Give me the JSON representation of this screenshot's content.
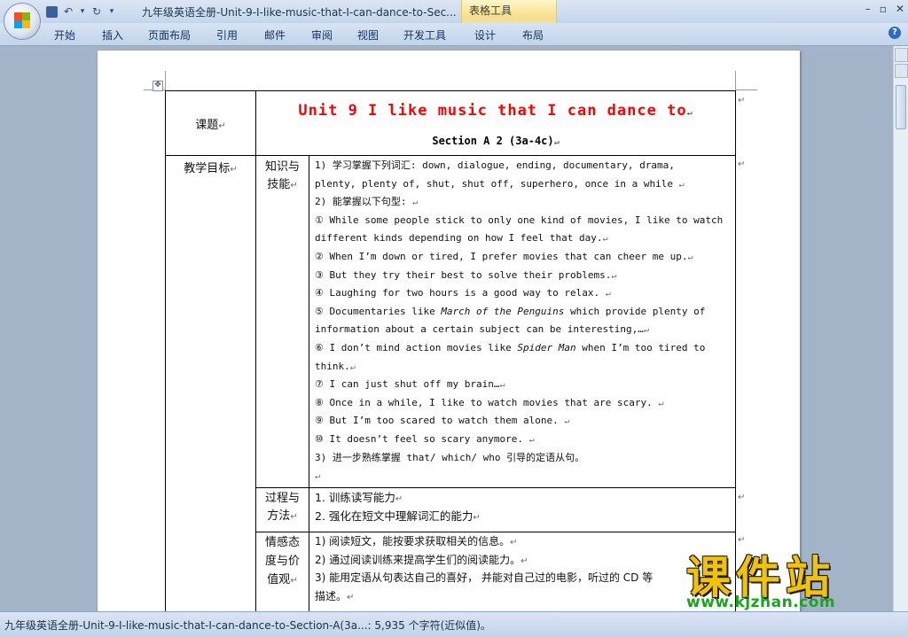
{
  "window": {
    "title": "九年级英语全册-Unit-9-I-like-music-that-I-can-dance-to-Sec...",
    "contextual_group": "表格工具",
    "controls": [
      "–",
      "▫",
      "✕"
    ]
  },
  "quick_access": {
    "undo_icon": "↶",
    "dropdown_icon": "▾",
    "redo_icon": "↻",
    "customize_icon": "▾"
  },
  "ribbon": {
    "tabs": [
      "开始",
      "插入",
      "页面布局",
      "引用",
      "邮件",
      "审阅",
      "视图",
      "开发工具",
      "设计",
      "布局"
    ],
    "help_icon": "?"
  },
  "document": {
    "table_handle": "✥",
    "paragraph_mark": "↵",
    "topic_label": "课题",
    "title": "Unit 9 I like music that I can dance to",
    "section": "Section A 2 (3a-4c)",
    "goals_label": "教学目标",
    "knowledge_label_1": "知识与",
    "knowledge_label_2": "技能",
    "knowledge_lines": {
      "l1": "1) 学习掌握下列词汇: down, dialogue, ending, documentary, drama,",
      "l2": "plenty, plenty of, shut, shut off, superhero, once in a while",
      "l3": "2) 能掌握以下句型:",
      "l4": "① While some people stick to only one kind of movies, I like to watch",
      "l5": "different kinds depending on how I feel that day.",
      "l6": "② When I’m down or tired, I prefer movies that can cheer me up.",
      "l7": "③ But they try their best to solve their problems.",
      "l8": "④ Laughing for two hours is a good way to relax.",
      "l9a": "⑤ Documentaries like ",
      "l9b": "March of the Penguins",
      "l9c": " which provide plenty of",
      "l10": "information about a certain subject can be interesting,…",
      "l11a": "⑥ I don’t mind action movies like ",
      "l11b": "Spider Man",
      "l11c": " when I’m too tired to",
      "l12": "think.",
      "l13": "⑦ I can just shut off my brain…",
      "l14": "⑧ Once in a while, I like to watch movies that are scary.",
      "l15": "⑨ But I’m too scared to watch them alone.",
      "l16": "⑩ It doesn’t feel so scary anymore.",
      "l17": "3) 进一步熟练掌握 that/ which/ who 引导的定语从句。"
    },
    "process_label_1": "过程与",
    "process_label_2": "方法",
    "process_lines": [
      "1.  训练读写能力",
      "2.  强化在短文中理解词汇的能力"
    ],
    "emotion_label_1": "情感态",
    "emotion_label_2": "度与价",
    "emotion_label_3": "值观",
    "emotion_lines": [
      "1) 阅读短文，能按要求获取相关的信息。",
      "2) 通过阅读训练来提高学生们的阅读能力。",
      "3) 能用定语从句表达自己的喜好， 并能对自己过的电影，听过的 CD 等",
      "描述。"
    ]
  },
  "watermark": {
    "text": "课件站",
    "url": "www.kjzhan.com"
  },
  "status": {
    "text": "九年级英语全册-Unit-9-I-like-music-that-I-can-dance-to-Section-A(3a...: 5,935 个字符(近似值)。"
  }
}
